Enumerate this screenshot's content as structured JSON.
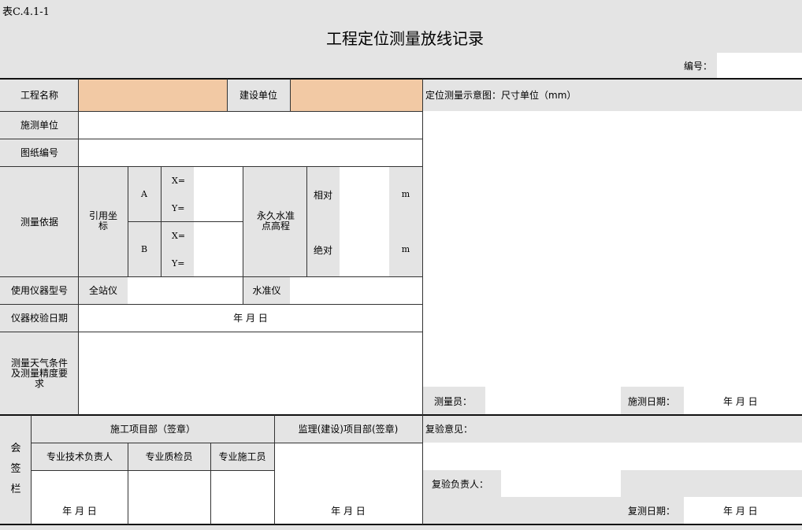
{
  "header": {
    "table_code": "表C.4.1-1",
    "title": "工程定位测量放线记录",
    "number_label": "编号："
  },
  "left": {
    "project_name_label": "工程名称",
    "build_unit_label": "建设单位",
    "survey_unit_label": "施测单位",
    "drawing_no_label": "图纸编号",
    "survey_basis_label": "测量依据",
    "ref_coord_label": "引用坐标",
    "point_a": "A",
    "point_b": "B",
    "x_label": "X=",
    "y_label": "Y=",
    "benchmark_label": "永久水准点高程",
    "relative_label": "相对",
    "absolute_label": "绝对",
    "unit_m": "m",
    "instrument_label": "使用仪器型号",
    "total_station_label": "全站仪",
    "level_label": "水准仪",
    "calib_date_label": "仪器校验日期",
    "date_text": "年  月  日",
    "weather_label": "测量天气条件及测量精度要求"
  },
  "right": {
    "diagram_label": "定位测量示意图：尺寸单位（mm）",
    "surveyor_label": "测量员：",
    "survey_date_label": "施测日期：",
    "recheck_opinion_label": "复验意见：",
    "recheck_person_label": "复验负责人：",
    "recheck_date_label": "复测日期：",
    "date_text": "年  月  日"
  },
  "sign": {
    "section_label": "会签栏",
    "construction_dept": "施工项目部（签章）",
    "supervision_dept": "监理(建设)项目部(签章)",
    "tech_lead": "专业技术负责人",
    "quality_inspector": "专业质检员",
    "constructor": "专业施工员",
    "date_text": "年  月  日"
  }
}
